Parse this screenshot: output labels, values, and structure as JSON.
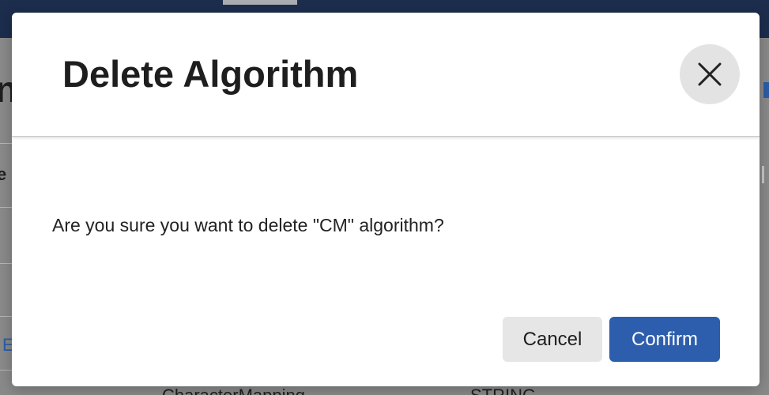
{
  "background": {
    "heading_fragment": "n",
    "column_fragment": "e",
    "link_fragment": "E",
    "bottom_cell_1": "CharacterMapping",
    "bottom_cell_2": "STRING"
  },
  "dialog": {
    "title": "Delete Algorithm",
    "close_icon": "close-icon",
    "message": "Are you sure you want to delete \"CM\" algorithm?",
    "cancel_label": "Cancel",
    "confirm_label": "Confirm"
  },
  "colors": {
    "topbar": "#1c2d4d",
    "confirm_button": "#2d5ead",
    "cancel_button": "#e6e6e6",
    "close_button": "#e3e3e3"
  }
}
